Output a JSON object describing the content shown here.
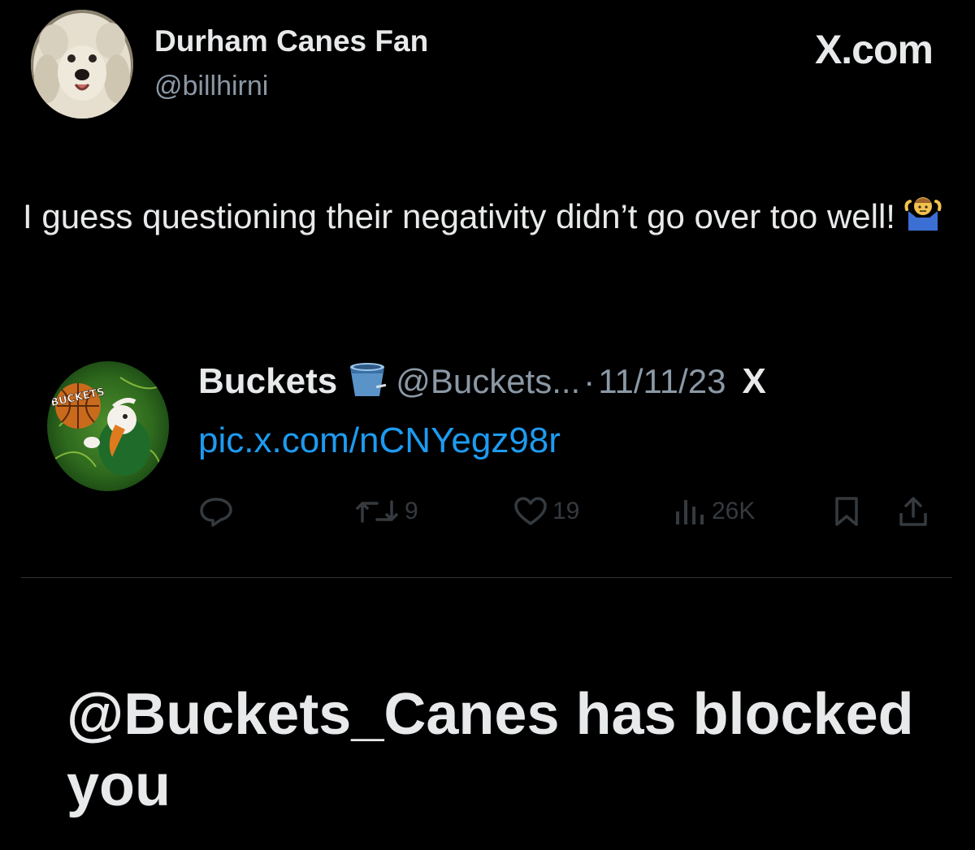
{
  "tweet": {
    "author_name": "Durham Canes Fan",
    "author_handle": "@billhirni",
    "site_label": "X.com",
    "text": "I guess questioning their negativity didn’t go over too well!",
    "emoji": "man-shrugging-icon"
  },
  "quoted_tweet": {
    "name": "Buckets",
    "name_emoji": "bucket-icon",
    "handle": "@Buckets...",
    "separator": "·",
    "date": "11/11/23",
    "x_mark": "X",
    "avatar_text": "BUCKETS",
    "link": "pic.x.com/nCNYegz98r",
    "actions": {
      "reply": "",
      "retweets": "9",
      "likes": "19",
      "views": "26K"
    }
  },
  "blocked_message": "@Buckets_Canes has blocked you",
  "colors": {
    "background": "#000000",
    "text": "#e7e9ea",
    "muted": "#8b98a5",
    "link": "#1d9bf0"
  }
}
